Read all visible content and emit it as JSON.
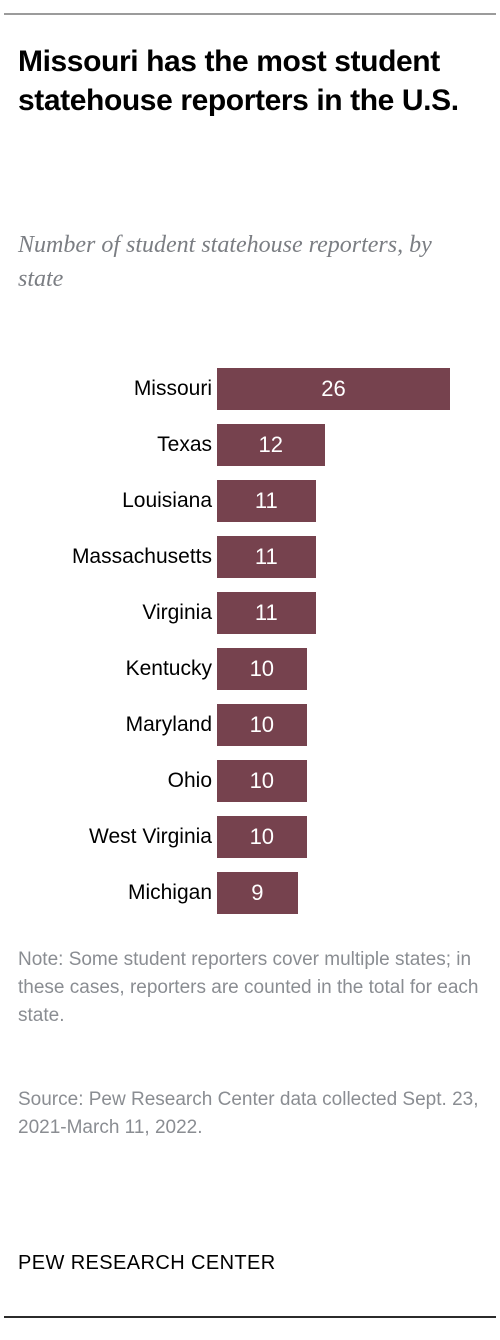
{
  "title": "Missouri has the most student statehouse reporters in the U.S.",
  "subtitle": "Number of student statehouse reporters, by state",
  "note": "Note: Some student reporters cover multiple states; in these cases, reporters are counted in the total for each state.",
  "source": "Source: Pew Research Center data collected Sept. 23, 2021-March 11, 2022.",
  "footer": "PEW RESEARCH CENTER",
  "colors": {
    "bar": "#76424e",
    "value_label": "#ffffff",
    "subtitle": "#7b7e83",
    "note": "#8a8d92",
    "rule_top": "#9b9b9b",
    "rule_bottom": "#2b2b2b"
  },
  "chart_data": {
    "type": "bar",
    "orientation": "horizontal",
    "title": "Missouri has the most student statehouse reporters in the U.S.",
    "subtitle": "Number of student statehouse reporters, by state",
    "xlabel": "",
    "ylabel": "",
    "xlim": [
      0,
      26
    ],
    "grid": false,
    "legend": false,
    "categories": [
      "Missouri",
      "Texas",
      "Louisiana",
      "Massachusetts",
      "Virginia",
      "Kentucky",
      "Maryland",
      "Ohio",
      "West Virginia",
      "Michigan"
    ],
    "values": [
      26,
      12,
      11,
      11,
      11,
      10,
      10,
      10,
      10,
      9
    ],
    "bars": [
      {
        "label": "Missouri",
        "value": 26
      },
      {
        "label": "Texas",
        "value": 12
      },
      {
        "label": "Louisiana",
        "value": 11
      },
      {
        "label": "Massachusetts",
        "value": 11
      },
      {
        "label": "Virginia",
        "value": 11
      },
      {
        "label": "Kentucky",
        "value": 10
      },
      {
        "label": "Maryland",
        "value": 10
      },
      {
        "label": "Ohio",
        "value": 10
      },
      {
        "label": "West Virginia",
        "value": 10
      },
      {
        "label": "Michigan",
        "value": 9
      }
    ]
  }
}
